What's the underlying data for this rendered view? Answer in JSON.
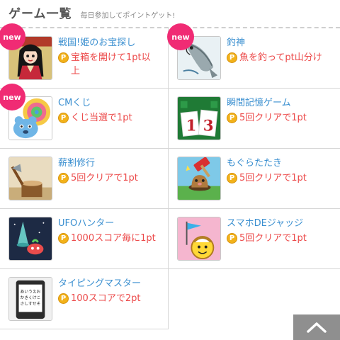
{
  "header": {
    "title": "ゲーム一覧",
    "subtitle": "毎日参加してポイントゲット!"
  },
  "games": [
    {
      "name": "戦国!姫のお宝探し",
      "reward": "宝箱を開けて1pt以上",
      "badge": "new"
    },
    {
      "name": "釣神",
      "reward": "魚を釣ってpt山分け",
      "badge": "new"
    },
    {
      "name": "CMくじ",
      "reward": "くじ当選で1pt",
      "badge": "new"
    },
    {
      "name": "瞬間記憶ゲーム",
      "reward": "5回クリアで1pt"
    },
    {
      "name": "薪割修行",
      "reward": "5回クリアで1pt"
    },
    {
      "name": "もぐらたたき",
      "reward": "5回クリアで1pt"
    },
    {
      "name": "UFOハンター",
      "reward": "1000スコア毎に1pt"
    },
    {
      "name": "スマホDEジャッジ",
      "reward": "5回クリアで1pt"
    },
    {
      "name": "タイピングマスター",
      "reward": "100スコアで2pt"
    }
  ],
  "thumbnails": {
    "memory_game_numbers": "13",
    "typing_master_text": "あいうえおかきくけこさしすせそたちつてとなに"
  },
  "coin_symbol": "P",
  "scroll_top_icon": "chevron-up-icon",
  "colors": {
    "link": "#3a8fd0",
    "reward": "#ec4a4a",
    "badge": "#f02b74",
    "coin": "#f2b21a"
  }
}
